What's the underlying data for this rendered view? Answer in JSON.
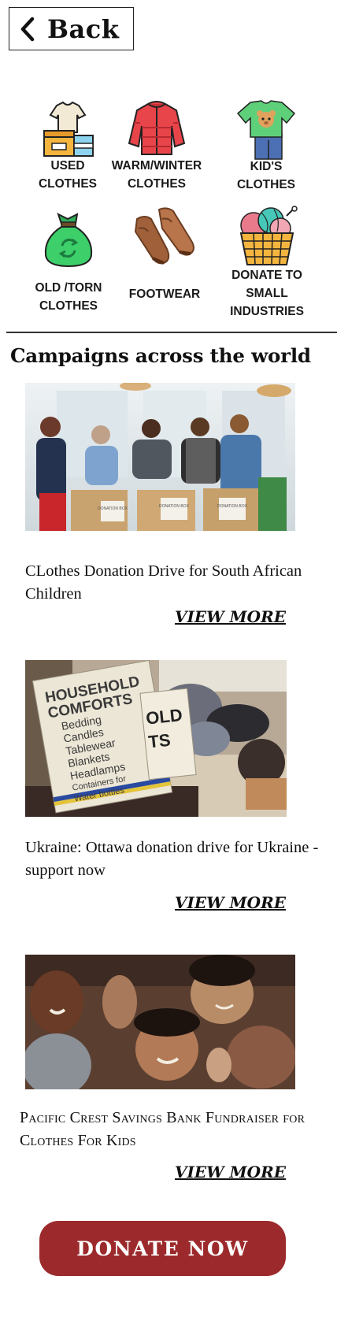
{
  "nav": {
    "back_label": "Back"
  },
  "categories": [
    {
      "icon": "used-clothes-icon",
      "label": "USED\nCLOTHES"
    },
    {
      "icon": "winter-jacket-icon",
      "label": "WARM/WINTER\nCLOTHES"
    },
    {
      "icon": "kids-clothes-icon",
      "label": "KID'S\nCLOTHES"
    },
    {
      "icon": "recycle-bag-icon",
      "label": "OLD /TORN\nCLOTHES"
    },
    {
      "icon": "shoes-icon",
      "label": "FOOTWEAR"
    },
    {
      "icon": "yarn-basket-icon",
      "label": "DONATE TO\nSMALL\nINDUSTRIES"
    }
  ],
  "section_title": "Campaigns across the world",
  "campaigns": [
    {
      "title": "CLothes Donation Drive for South African Children",
      "view_more": "VIEW MORE",
      "photo_text": [
        "DONATION BOX",
        "DONATION BOX",
        "DONATION BOX"
      ]
    },
    {
      "title": "Ukraine: Ottawa donation drive for Ukraine  -support now",
      "view_more": "VIEW MORE",
      "photo_text": [
        "HOUSEHOLD",
        "COMFORTS",
        "Bedding",
        "Candles",
        "Tablewear",
        "Blankets",
        "Headlamps",
        "Containers for",
        "Water bottles",
        "OLD",
        "TS"
      ]
    },
    {
      "title": "Pacific Crest Savings Bank Fundraiser for Clothes For Kids",
      "view_more": "VIEW MORE"
    }
  ],
  "donate_label": "DONATE  NOW",
  "colors": {
    "donate_button": "#9c2a2c"
  }
}
